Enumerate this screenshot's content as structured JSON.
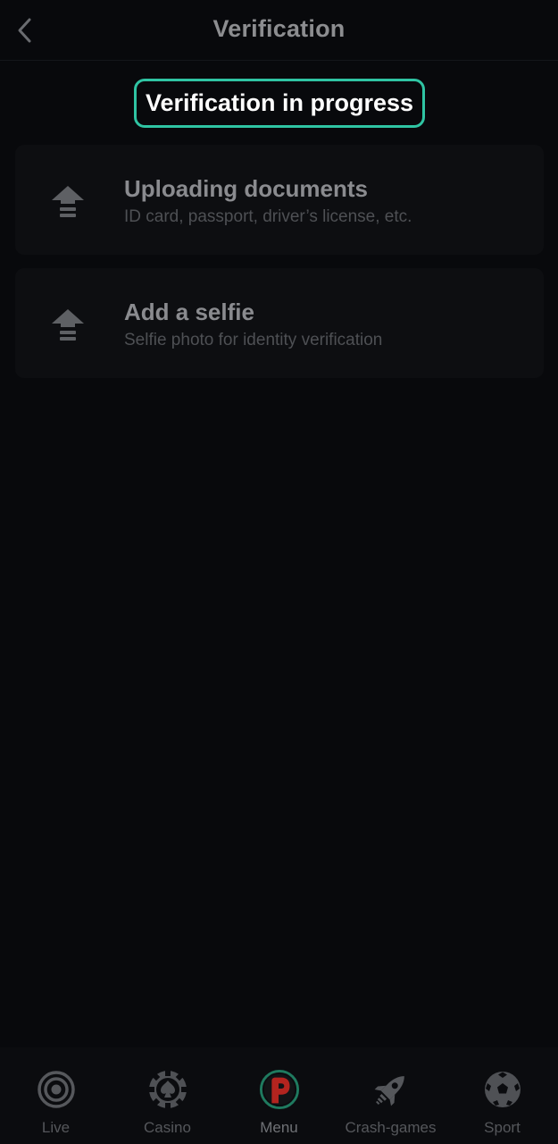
{
  "header": {
    "title": "Verification",
    "back_icon": "chevron-left-icon"
  },
  "status": {
    "label": "Verification in progress",
    "accent_color": "#2fc4a3"
  },
  "cards": [
    {
      "title": "Uploading documents",
      "subtitle": "ID card, passport, driver’s license, etc.",
      "icon": "upload-icon"
    },
    {
      "title": "Add a selfie",
      "subtitle": "Selfie photo for identity verification",
      "icon": "upload-icon"
    }
  ],
  "bottom_nav": {
    "items": [
      {
        "label": "Live",
        "icon": "live-icon"
      },
      {
        "label": "Casino",
        "icon": "casino-chip-icon"
      },
      {
        "label": "Menu",
        "icon": "brand-logo-icon",
        "active": true
      },
      {
        "label": "Crash-games",
        "icon": "rocket-icon"
      },
      {
        "label": "Sport",
        "icon": "soccer-ball-icon"
      }
    ]
  }
}
